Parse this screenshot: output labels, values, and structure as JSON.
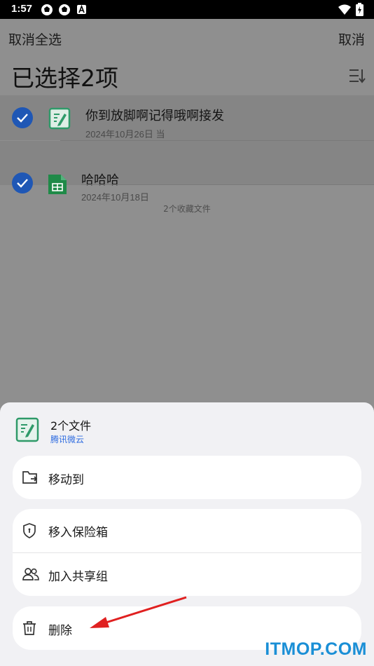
{
  "status_bar": {
    "time": "1:57",
    "icons": [
      "aperture-icon",
      "aperture-icon",
      "text-a-icon",
      "wifi-icon",
      "battery-charging-icon"
    ]
  },
  "header": {
    "cancel_select_all": "取消全选",
    "cancel": "取消",
    "title": "已选择2项"
  },
  "files": [
    {
      "name": "你到放脚啊记得哦啊接发",
      "date": "2024年10月26日 当",
      "icon": "note-doc-icon",
      "selected": true
    },
    {
      "name": "哈哈哈",
      "date": "2024年10月18日",
      "icon": "sheet-doc-icon",
      "selected": true
    }
  ],
  "files_count_text": "2个收藏文件",
  "sheet": {
    "title": "2个文件",
    "subtitle": "腾讯微云",
    "actions": {
      "move_to": "移动到",
      "move_to_vault": "移入保险箱",
      "add_to_share_group": "加入共享组",
      "delete": "删除"
    }
  },
  "watermark": "ITMOP.COM",
  "colors": {
    "accent": "#1f57b5",
    "link_blue": "#2d6be0",
    "annotation_arrow": "#e02020",
    "watermark": "#1a8fd6"
  }
}
